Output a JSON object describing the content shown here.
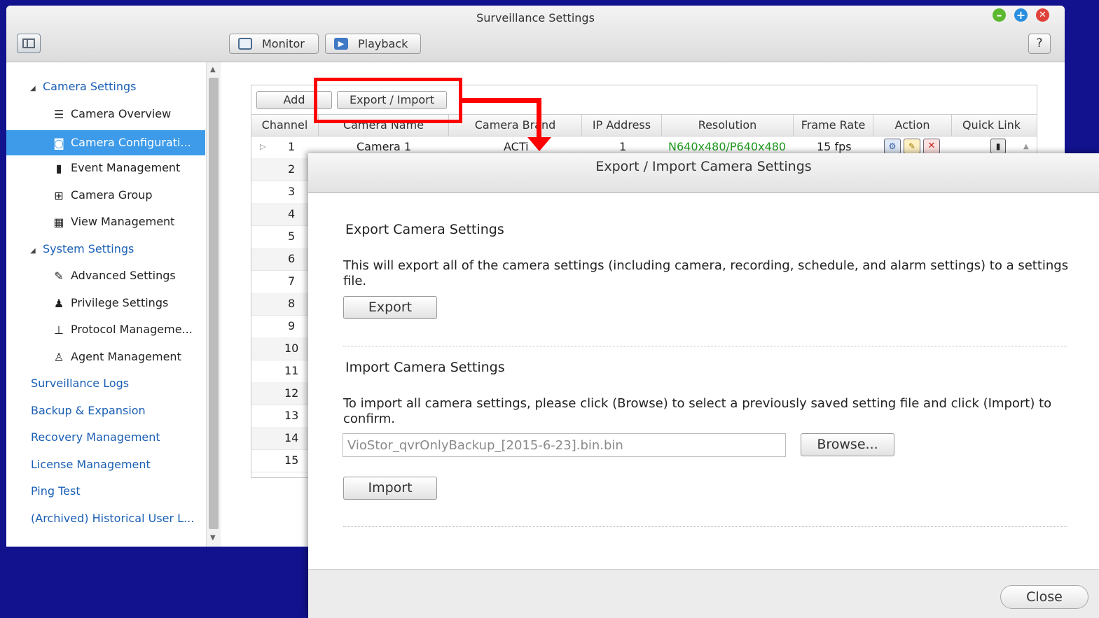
{
  "window": {
    "title": "Surveillance Settings",
    "controls": {
      "minimize": "minimize-icon",
      "maximize": "plus-icon",
      "close": "close-icon"
    },
    "toolbar": {
      "monitor_label": "Monitor",
      "playback_label": "Playback",
      "help_label": "?"
    }
  },
  "sidebar": {
    "items": [
      {
        "label": "Camera Settings",
        "level": 0,
        "expanded": true
      },
      {
        "label": "Camera Overview",
        "level": 1,
        "icon": "list-icon"
      },
      {
        "label": "Camera Configurati...",
        "level": 1,
        "icon": "camera-icon",
        "selected": true
      },
      {
        "label": "Event Management",
        "level": 1,
        "icon": "alert-icon"
      },
      {
        "label": "Camera Group",
        "level": 1,
        "icon": "group-icon"
      },
      {
        "label": "View Management",
        "level": 1,
        "icon": "grid-icon"
      },
      {
        "label": "System Settings",
        "level": 0,
        "expanded": true
      },
      {
        "label": "Advanced Settings",
        "level": 1,
        "icon": "wrench-icon"
      },
      {
        "label": "Privilege Settings",
        "level": 1,
        "icon": "user-icon"
      },
      {
        "label": "Protocol Manageme...",
        "level": 1,
        "icon": "network-icon"
      },
      {
        "label": "Agent Management",
        "level": 1,
        "icon": "agent-icon"
      },
      {
        "label": "Surveillance Logs",
        "level": 0
      },
      {
        "label": "Backup & Expansion",
        "level": 0
      },
      {
        "label": "Recovery Management",
        "level": 0
      },
      {
        "label": "License Management",
        "level": 0
      },
      {
        "label": "Ping Test",
        "level": 0
      },
      {
        "label": "(Archived) Historical User L...",
        "level": 0
      }
    ]
  },
  "panel": {
    "add_label": "Add",
    "export_import_label": "Export / Import",
    "columns": [
      "Channel",
      "Camera Name",
      "Camera Brand",
      "IP Address",
      "Resolution",
      "Frame Rate",
      "Action",
      "Quick Link"
    ],
    "first_row": {
      "channel": "1",
      "name": "Camera 1",
      "brand": "ACTi",
      "ip": "1",
      "resolution": "N640x480/P640x480",
      "frame_rate": "15 fps"
    },
    "channels": [
      "2",
      "3",
      "4",
      "5",
      "6",
      "7",
      "8",
      "9",
      "10",
      "11",
      "12",
      "13",
      "14",
      "15"
    ]
  },
  "dialog": {
    "title": "Export / Import Camera Settings",
    "export_heading": "Export Camera Settings",
    "export_text": "This will export all of the camera settings (including camera, recording, schedule, and alarm settings) to a settings file.",
    "export_button": "Export",
    "import_heading": "Import Camera Settings",
    "import_text": "To import all camera settings, please click (Browse) to select a previously saved setting file and click (Import) to confirm.",
    "file_value": "VioStor_qvrOnlyBackup_[2015-6-23].bin.bin",
    "browse_button": "Browse...",
    "import_button": "Import",
    "close_button": "Close"
  },
  "colors": {
    "background": "#12128e",
    "selection": "#3d9be9",
    "link": "#1a5fb4",
    "highlight": "#ff0000",
    "resolution_text": "#1e9a1e"
  }
}
